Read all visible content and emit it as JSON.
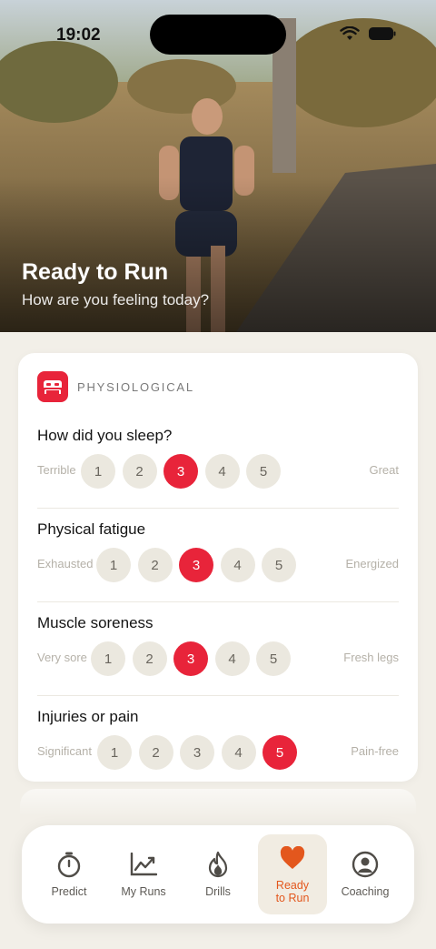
{
  "status_bar": {
    "time": "19:02"
  },
  "hero": {
    "title": "Ready to Run",
    "subtitle": "How are you feeling today?"
  },
  "section": {
    "label": "PHYSIOLOGICAL",
    "icon": "bed-icon",
    "accent": "#e8243a"
  },
  "questions": [
    {
      "title": "How did you sleep?",
      "low": "Terrible",
      "high": "Great",
      "options": [
        "1",
        "2",
        "3",
        "4",
        "5"
      ],
      "selected": 3
    },
    {
      "title": "Physical fatigue",
      "low": "Exhausted",
      "high": "Energized",
      "options": [
        "1",
        "2",
        "3",
        "4",
        "5"
      ],
      "selected": 3
    },
    {
      "title": "Muscle soreness",
      "low": "Very sore",
      "high": "Fresh legs",
      "options": [
        "1",
        "2",
        "3",
        "4",
        "5"
      ],
      "selected": 3
    },
    {
      "title": "Injuries or pain",
      "low": "Significant",
      "high": "Pain-free",
      "options": [
        "1",
        "2",
        "3",
        "4",
        "5"
      ],
      "selected": 5
    }
  ],
  "tabs": [
    {
      "label": "Predict",
      "icon": "stopwatch-icon",
      "active": false
    },
    {
      "label": "My Runs",
      "icon": "chart-icon",
      "active": false
    },
    {
      "label": "Drills",
      "icon": "flame-icon",
      "active": false
    },
    {
      "label": "Ready\nto Run",
      "icon": "heart-icon",
      "active": true
    },
    {
      "label": "Coaching",
      "icon": "person-icon",
      "active": false
    }
  ],
  "colors": {
    "accent": "#e8243a",
    "tab_active": "#e3571d",
    "background": "#f2efe8"
  }
}
